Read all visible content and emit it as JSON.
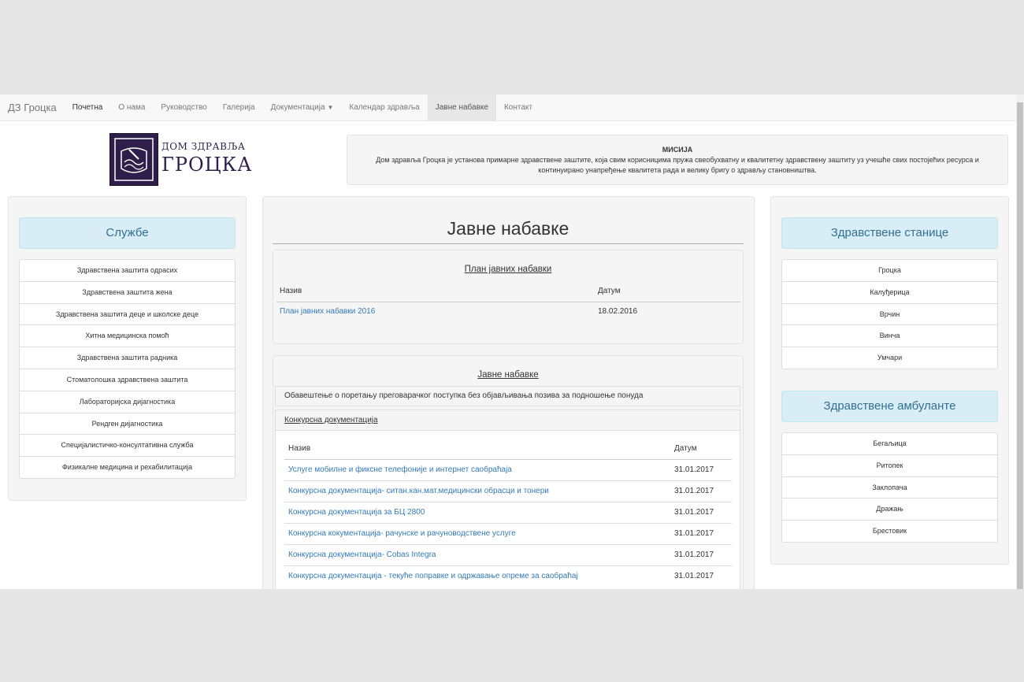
{
  "nav": {
    "brand": "ДЗ Гроцка",
    "items": [
      "Почетна",
      "О нама",
      "Руководство",
      "Галерија",
      "Документација",
      "Календар здравља",
      "Јавне набавке",
      "Контакт"
    ]
  },
  "logo": {
    "line1": "ДОМ ЗДРАВЉА",
    "line2": "ГРОЦКА"
  },
  "mission": {
    "title": "МИСИЈА",
    "line1": "Дом здравља Гроцка је установа примарне здравствене заштите, која свим корисницима пружа свеобухватну и квалитетну здравствену заштиту уз учешће свих постојећих ресурса и",
    "line2": "континуирано унапређење квалитета рада и велику бригу о здрављу становништва."
  },
  "services": {
    "title": "Службе",
    "items": [
      "Здравствена заштита одрасих",
      "Здравствена заштита жена",
      "Здравствена заштита деце и школске деце",
      "Хитна медицинска помоћ",
      "Здравствена заштита радника",
      "Стоматолошка здравствена заштита",
      "Лабораторијска дијагностика",
      "Рендген дијагностика",
      "Специјалистичко-консултативна служба",
      "Физикалне медицина и рехабилитација"
    ]
  },
  "stations": {
    "title": "Здравствене станице",
    "items": [
      "Гроцка",
      "Калуђерица",
      "Врчин",
      "Винча",
      "Умчари"
    ]
  },
  "clinics": {
    "title": "Здравствене амбуланте",
    "items": [
      "Бегаљица",
      "Ритопек",
      "Заклопача",
      "Дражањ",
      "Брестовик"
    ]
  },
  "main": {
    "title": "Јавне набавке",
    "plan": {
      "heading": "План јавних набавки",
      "col_name": "Назив",
      "col_date": "Датум",
      "rows": [
        {
          "name": "План јавних набавки 2016",
          "date": "18.02.2016"
        }
      ]
    },
    "procurements": {
      "heading": "Јавне набавке",
      "notice": "Обавештење о поретању преговарачког поступка без објављивања позива за подношење понуда",
      "tender_heading": "Конкурсна документација",
      "col_name": "Назив",
      "col_date": "Датум",
      "rows": [
        {
          "name": "Услуге мобилне и фиксне телефоније и интернет саобраћаја",
          "date": "31.01.2017"
        },
        {
          "name": "Конкурсна документација- ситан.кан.мат.медицински обрасци и тонери",
          "date": "31.01.2017"
        },
        {
          "name": "Конкурсна документација за БЦ 2800",
          "date": "31.01.2017"
        },
        {
          "name": "Конкурсна кокументација- рачунске и рачуноводствене услуге",
          "date": "31.01.2017"
        },
        {
          "name": "Конкурсна документација- Cobas Integra",
          "date": "31.01.2017"
        },
        {
          "name": "Конкурсна документација - текуће поправке и одржавање опреме за саобраћај",
          "date": "31.01.2017"
        }
      ]
    }
  }
}
